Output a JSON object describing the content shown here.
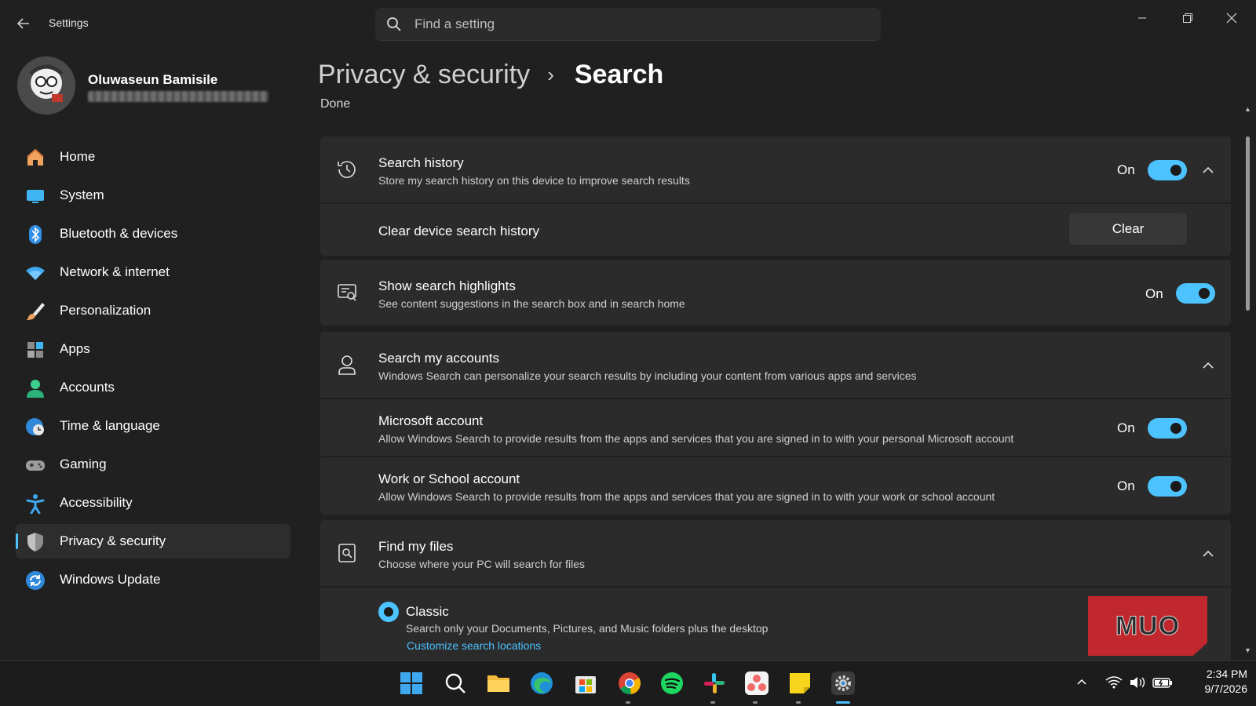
{
  "window": {
    "title": "Settings",
    "search_placeholder": "Find a setting"
  },
  "profile": {
    "name": "Oluwaseun Bamisile"
  },
  "sidebar": {
    "items": [
      {
        "label": "Home",
        "icon": "home-icon"
      },
      {
        "label": "System",
        "icon": "system-icon"
      },
      {
        "label": "Bluetooth & devices",
        "icon": "bluetooth-icon"
      },
      {
        "label": "Network & internet",
        "icon": "wifi-icon"
      },
      {
        "label": "Personalization",
        "icon": "brush-icon"
      },
      {
        "label": "Apps",
        "icon": "apps-icon"
      },
      {
        "label": "Accounts",
        "icon": "accounts-icon"
      },
      {
        "label": "Time & language",
        "icon": "globe-clock-icon"
      },
      {
        "label": "Gaming",
        "icon": "gamepad-icon"
      },
      {
        "label": "Accessibility",
        "icon": "accessibility-icon"
      },
      {
        "label": "Privacy & security",
        "icon": "shield-icon",
        "active": true
      },
      {
        "label": "Windows Update",
        "icon": "update-icon"
      }
    ]
  },
  "breadcrumb": {
    "parent": "Privacy & security",
    "separator": "›",
    "current": "Search"
  },
  "partial_text": "Done",
  "settings": {
    "search_history": {
      "title": "Search history",
      "description": "Store my search history on this device to improve search results",
      "state": "On"
    },
    "clear_history": {
      "title": "Clear device search history",
      "button": "Clear"
    },
    "highlights": {
      "title": "Show search highlights",
      "description": "See content suggestions in the search box and in search home",
      "state": "On"
    },
    "accounts": {
      "title": "Search my accounts",
      "description": "Windows Search can personalize your search results by including your content from various apps and services"
    },
    "microsoft_account": {
      "title": "Microsoft account",
      "description": "Allow Windows Search to provide results from the apps and services that you are signed in to with your personal Microsoft account",
      "state": "On"
    },
    "work_account": {
      "title": "Work or School account",
      "description": "Allow Windows Search to provide results from the apps and services that you are signed in to with your work or school account",
      "state": "On"
    },
    "find_files": {
      "title": "Find my files",
      "description": "Choose where your PC will search for files"
    },
    "classic": {
      "title": "Classic",
      "description": "Search only your Documents, Pictures, and Music folders plus the desktop",
      "link": "Customize search locations"
    }
  },
  "watermark": "MUO",
  "taskbar": {
    "apps": [
      "start-icon",
      "search-icon",
      "file-explorer-icon",
      "edge-icon",
      "store-icon",
      "chrome-icon",
      "spotify-icon",
      "slack-icon",
      "asana-icon",
      "sticky-notes-icon",
      "settings-icon"
    ],
    "time": "2:34 PM",
    "date": "9/7/2026"
  },
  "colors": {
    "accent": "#4cc2ff",
    "background": "#202020",
    "card": "#2b2b2b"
  }
}
